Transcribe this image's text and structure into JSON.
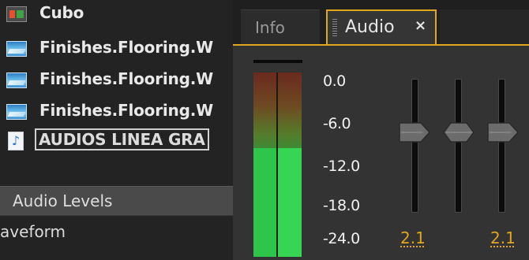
{
  "project_panel": {
    "items": [
      {
        "label": "Cubo",
        "icon": "sequence-icon",
        "selected": false
      },
      {
        "label": "Finishes.Flooring.W",
        "icon": "image-file-icon",
        "selected": false
      },
      {
        "label": "Finishes.Flooring.W",
        "icon": "image-file-icon",
        "selected": false
      },
      {
        "label": "Finishes.Flooring.W",
        "icon": "image-file-icon",
        "selected": false
      },
      {
        "label": "AUDIOS LINEA GRA",
        "icon": "audio-file-icon",
        "selected": true
      }
    ],
    "audio_levels_label": "Audio Levels",
    "waveform_label": "aveform"
  },
  "tabs": [
    {
      "label": "Info",
      "active": false
    },
    {
      "label": "Audio",
      "active": true,
      "close": "×"
    }
  ],
  "meter": {
    "scale": [
      "0.0",
      "-6.0",
      "-12.0",
      "-18.0",
      "-24.0"
    ],
    "level_fraction": 0.59
  },
  "faders": [
    {
      "value": "2.1"
    },
    {
      "value": ""
    },
    {
      "value": "2.1"
    }
  ],
  "colors": {
    "accent": "#e1a61d",
    "meter_green": "#2ec64a",
    "meter_red": "#6a2a1e"
  }
}
